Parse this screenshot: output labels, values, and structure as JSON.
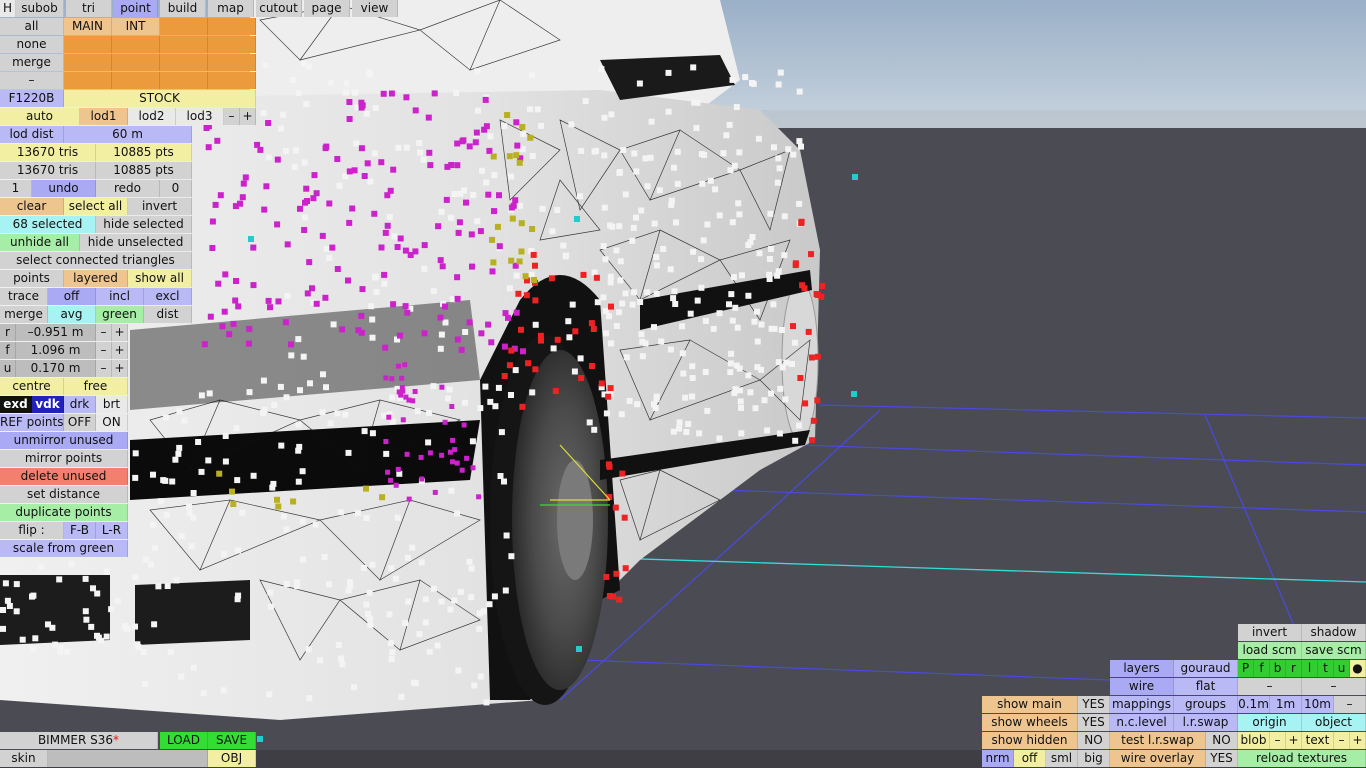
{
  "topbar": {
    "h": "H",
    "tabs": [
      "subob",
      "tri",
      "point",
      "build",
      "map",
      "cutout",
      "page",
      "view"
    ]
  },
  "select": {
    "all": "all",
    "main": "MAIN",
    "int": "INT",
    "none": "none",
    "merge": "merge",
    "dash": "–"
  },
  "model": {
    "code": "F1220B",
    "variant": "STOCK"
  },
  "lod": {
    "auto": "auto",
    "lod1": "lod1",
    "lod2": "lod2",
    "lod3": "lod3",
    "minus": "–",
    "plus": "+",
    "dist_label": "lod dist",
    "dist_value": "60 m"
  },
  "stats": {
    "tris1": "13670 tris",
    "pts1": "10885 pts",
    "tris2": "13670 tris",
    "pts2": "10885 pts"
  },
  "history": {
    "count": "1",
    "undo": "undo",
    "redo": "redo",
    "redo_count": "0"
  },
  "selection": {
    "clear": "clear",
    "select_all": "select all",
    "invert": "invert",
    "selected": "68 selected",
    "hide_selected": "hide selected",
    "unhide_all": "unhide all",
    "hide_unselected": "hide unselected",
    "select_connected": "select connected triangles",
    "points": "points",
    "layered": "layered",
    "show_all": "show all"
  },
  "trace": {
    "label": "trace",
    "off": "off",
    "incl": "incl",
    "excl": "excl"
  },
  "merge2": {
    "merge": "merge",
    "avg": "avg",
    "green": "green",
    "dist": "dist"
  },
  "coords": {
    "r_label": "r",
    "r_value": "–0.951 m",
    "f_label": "f",
    "f_value": "1.096 m",
    "u_label": "u",
    "u_value": "0.170 m",
    "minus": "–",
    "plus": "+"
  },
  "pivot": {
    "centre": "centre",
    "free": "free"
  },
  "shade": {
    "exd": "exd",
    "vdk": "vdk",
    "drk": "drk",
    "brt": "brt"
  },
  "ref": {
    "label": "REF points",
    "off": "OFF",
    "on": "ON"
  },
  "tools": {
    "unmirror_unused": "unmirror unused",
    "mirror_points": "mirror points",
    "delete_unused": "delete unused",
    "set_distance": "set distance",
    "duplicate_points": "duplicate points",
    "flip": "flip :",
    "fb": "F-B",
    "lr": "L-R",
    "scale_from_green": "scale from green"
  },
  "file": {
    "name": "BIMMER S36",
    "star": "*",
    "load": "LOAD",
    "save": "SAVE",
    "skin": "skin",
    "obj": "OBJ"
  },
  "right_panel": {
    "invert": "invert",
    "shadow": "shadow",
    "load_scm": "load scm",
    "save_scm": "save scm",
    "layers": "layers",
    "gouraud": "gouraud",
    "flags": [
      "P",
      "f",
      "b",
      "r",
      "l",
      "t",
      "u",
      "●"
    ],
    "wire": "wire",
    "flat": "flat",
    "dash": "–",
    "show_main": "show main",
    "show_main_val": "YES",
    "mappings": "mappings",
    "groups": "groups",
    "d01": "0.1m",
    "d1": "1m",
    "d10": "10m",
    "dminus": "–",
    "show_wheels": "show wheels",
    "show_wheels_val": "YES",
    "nc_level": "n.c.level",
    "lr_swap": "l.r.swap",
    "origin": "origin",
    "object": "object",
    "show_hidden": "show hidden",
    "show_hidden_val": "NO",
    "test_lr_swap": "test l.r.swap",
    "test_val": "NO",
    "blob": "blob",
    "text": "text",
    "minus": "–",
    "plus": "+",
    "nrm": "nrm",
    "off": "off",
    "sml": "sml",
    "big": "big",
    "wire_overlay": "wire overlay",
    "wire_overlay_val": "YES",
    "reload_textures": "reload textures"
  }
}
